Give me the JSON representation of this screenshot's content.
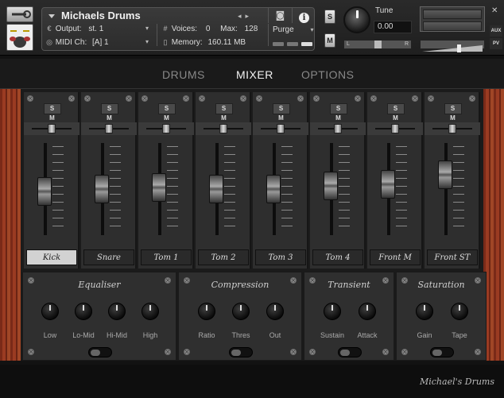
{
  "header": {
    "instrument_name": "Michaels Drums",
    "output_label": "Output:",
    "output_value": "st. 1",
    "voices_label": "Voices:",
    "voices_value": "0",
    "max_label": "Max:",
    "max_value": "128",
    "midi_label": "MIDI Ch:",
    "midi_value": "[A]  1",
    "memory_label": "Memory:",
    "memory_value": "160.11 MB",
    "purge_label": "Purge",
    "solo_label": "S",
    "mute_label": "M",
    "tune_label": "Tune",
    "tune_value": "0.00",
    "pan_left": "L",
    "pan_right": "R",
    "aux_label": "AUX",
    "pv_label": "PV"
  },
  "tabs": [
    {
      "label": "DRUMS",
      "active": false
    },
    {
      "label": "MIXER",
      "active": true
    },
    {
      "label": "OPTIONS",
      "active": false
    }
  ],
  "mixer": {
    "solo_mute_label": "S M",
    "channels": [
      {
        "name": "Kick",
        "fader_level": 0.46,
        "pan": 0.5,
        "selected": true
      },
      {
        "name": "Snare",
        "fader_level": 0.5,
        "pan": 0.5,
        "selected": false
      },
      {
        "name": "Tom 1",
        "fader_level": 0.52,
        "pan": 0.5,
        "selected": false
      },
      {
        "name": "Tom 2",
        "fader_level": 0.5,
        "pan": 0.5,
        "selected": false
      },
      {
        "name": "Tom 3",
        "fader_level": 0.5,
        "pan": 0.5,
        "selected": false
      },
      {
        "name": "Tom 4",
        "fader_level": 0.55,
        "pan": 0.5,
        "selected": false
      },
      {
        "name": "Front M",
        "fader_level": 0.58,
        "pan": 0.5,
        "selected": false
      },
      {
        "name": "Front ST",
        "fader_level": 0.72,
        "pan": 0.5,
        "selected": false
      }
    ]
  },
  "effects": [
    {
      "title": "Equaliser",
      "knobs": [
        "Low",
        "Lo-Mid",
        "Hi-Mid",
        "High"
      ],
      "enabled": false
    },
    {
      "title": "Compression",
      "knobs": [
        "Ratio",
        "Thres",
        "Out"
      ],
      "enabled": false
    },
    {
      "title": "Transient",
      "knobs": [
        "Sustain",
        "Attack"
      ],
      "enabled": false
    },
    {
      "title": "Saturation",
      "knobs": [
        "Gain",
        "Tape"
      ],
      "enabled": false
    }
  ],
  "footer": {
    "brand": "Michael's Drums"
  }
}
